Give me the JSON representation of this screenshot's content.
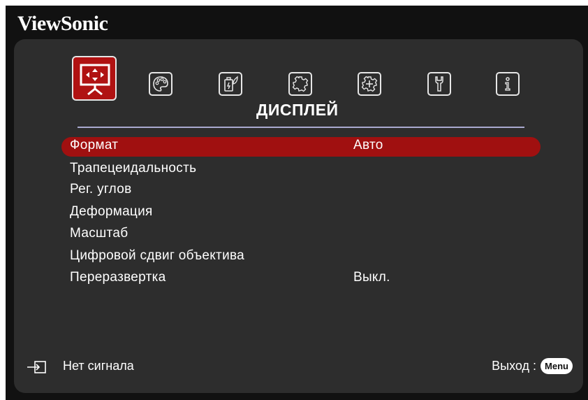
{
  "brand": "ViewSonic",
  "tabs": [
    {
      "name": "display-icon",
      "active": true
    },
    {
      "name": "image-settings-icon",
      "active": false
    },
    {
      "name": "power-management-icon",
      "active": false
    },
    {
      "name": "basic-settings-icon",
      "active": false
    },
    {
      "name": "advanced-settings-icon",
      "active": false
    },
    {
      "name": "maintenance-icon",
      "active": false
    },
    {
      "name": "information-icon",
      "active": false
    }
  ],
  "active_tab_title": "ДИСПЛЕЙ",
  "menu_items": [
    {
      "label": "Формат",
      "value": "Авто",
      "selected": true
    },
    {
      "label": "Трапецеидальность",
      "value": ""
    },
    {
      "label": "Рег. углов",
      "value": ""
    },
    {
      "label": "Деформация",
      "value": ""
    },
    {
      "label": "Масштаб",
      "value": ""
    },
    {
      "label": "Цифровой сдвиг объектива",
      "value": ""
    },
    {
      "label": "Переразвертка",
      "value": "Выкл."
    }
  ],
  "footer": {
    "source_icon": "input-source-icon",
    "status": "Нет сигнала",
    "exit_label": "Выход :",
    "menu_key": "Menu"
  },
  "colors": {
    "highlight": "#a01010",
    "panel": "#2d2d2d",
    "background": "#111111",
    "separator": "#a9a9cf"
  }
}
